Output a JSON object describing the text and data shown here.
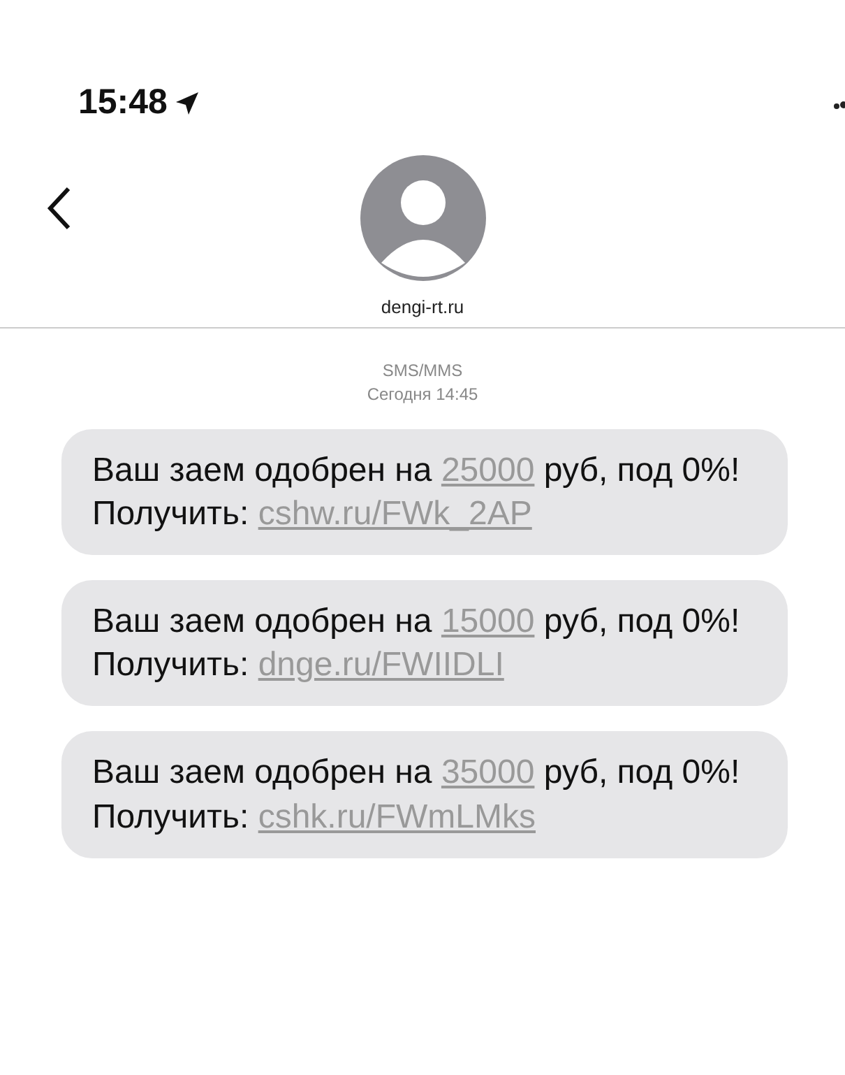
{
  "status_bar": {
    "time": "15:48"
  },
  "header": {
    "contact": "dengi-rt.ru"
  },
  "thread_info": {
    "service": "SMS/MMS",
    "date": "Сегодня 14:45"
  },
  "messages": [
    {
      "before": "Ваш заем одобрен на ",
      "amount": "25000",
      "middle": " руб, под 0%! Получить: ",
      "link": "cshw.ru/FWk_2AP"
    },
    {
      "before": "Ваш заем одобрен на ",
      "amount": "15000",
      "middle": " руб, под 0%! Получить: ",
      "link": "dnge.ru/FWIIDLI"
    },
    {
      "before": "Ваш заем одобрен на ",
      "amount": "35000",
      "middle": " руб, под 0%! Получить: ",
      "link": "cshk.ru/FWmLMks"
    }
  ]
}
